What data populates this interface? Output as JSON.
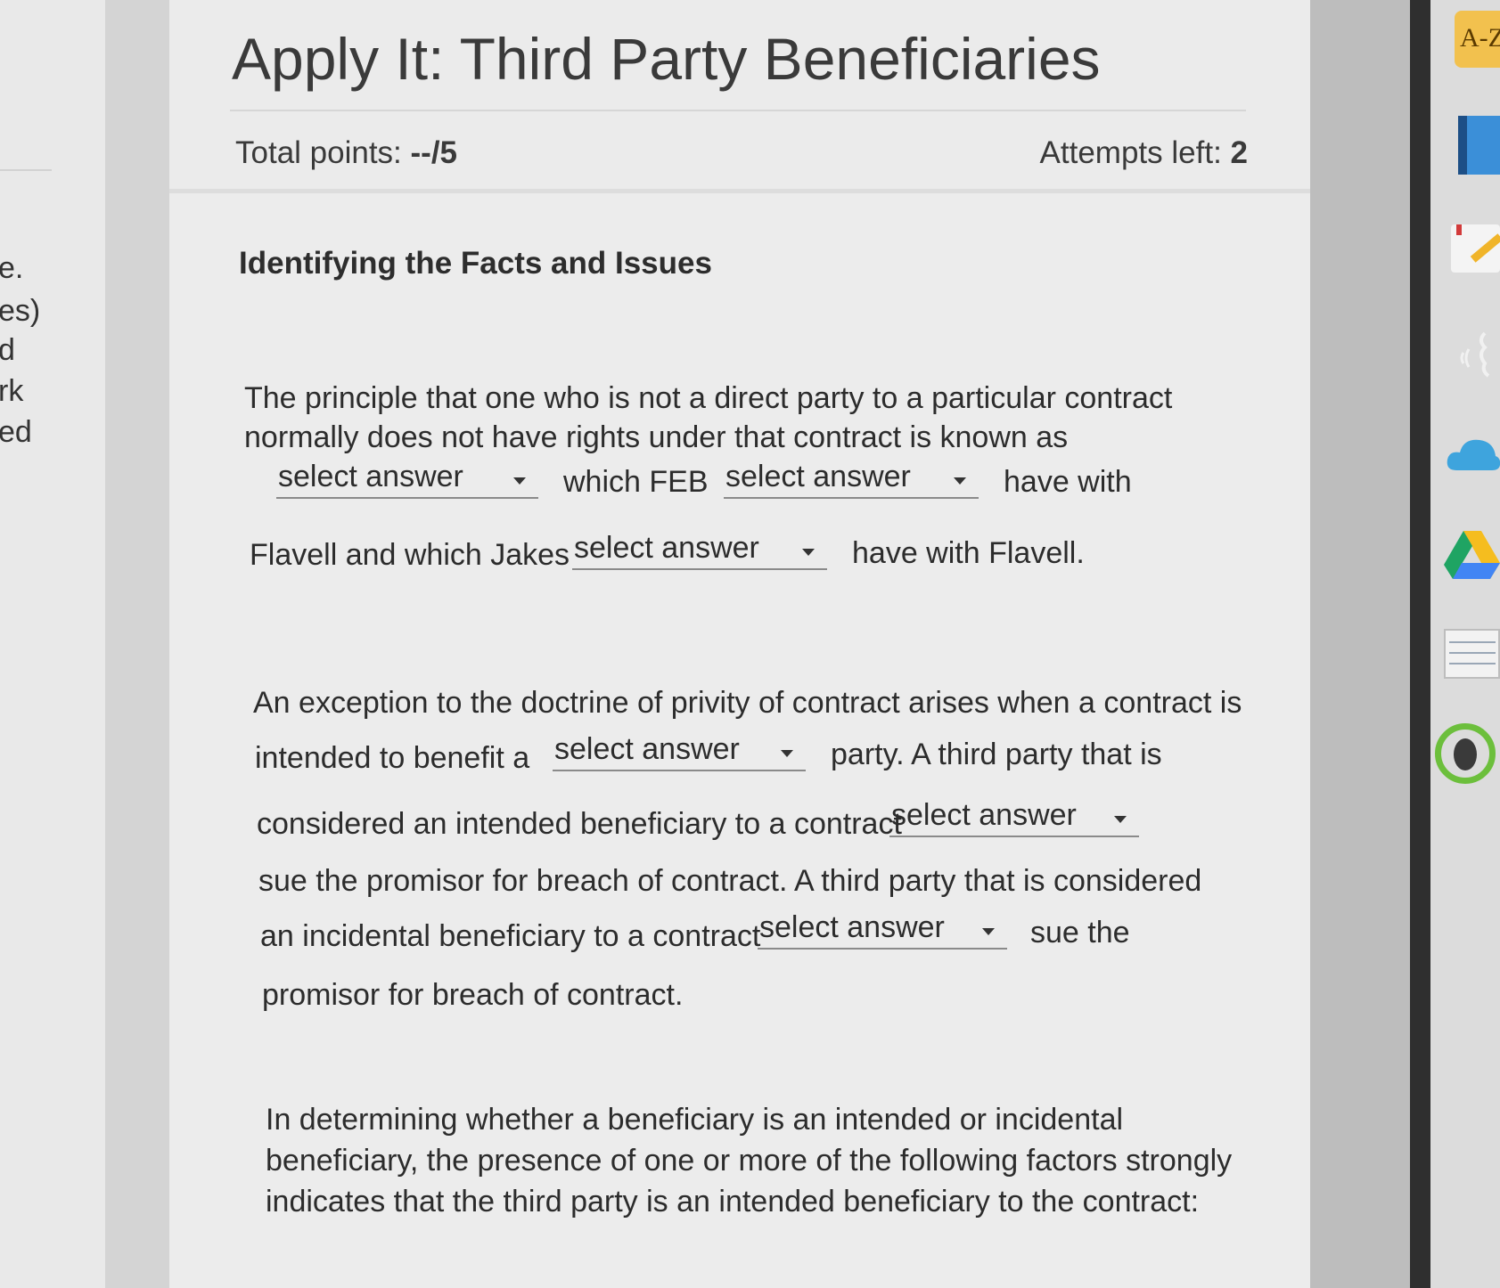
{
  "left_panel": {
    "fragments": [
      "e.",
      "es)",
      "d",
      "rk",
      "ed"
    ]
  },
  "header": {
    "title": "Apply It: Third Party Beneficiaries",
    "total_points_label": "Total points:",
    "total_points_value": "--/5",
    "attempts_label": "Attempts left:",
    "attempts_value": "2"
  },
  "section": {
    "title": "Identifying the Facts and Issues"
  },
  "question1": {
    "line1": "The principle that one who is not a direct party to a particular contract",
    "line2": "normally does not have rights under that contract is known as",
    "text_which_feb": "which FEB",
    "text_have_with": "have with",
    "text_flavell_jakes": "Flavell and which Jakes",
    "text_have_with_flavell": "have with Flavell."
  },
  "question2": {
    "line1": "An exception to the doctrine of privity of contract arises when a contract is",
    "text_intended": "intended to benefit a",
    "text_party": "party. A third party that is",
    "text_considered": "considered an intended beneficiary to a contract",
    "line_sue": "sue the promisor for breach of contract. A third party that is considered",
    "text_incidental": "an incidental beneficiary to a contract",
    "text_sue_the": "sue the",
    "line_end": "promisor for breach of contract."
  },
  "question3": {
    "line1": "In determining whether a beneficiary is an intended or incidental",
    "line2": "beneficiary, the presence of one or more of the following factors strongly",
    "line3": "indicates that the third party is an intended beneficiary to the contract:"
  },
  "dropdown_placeholder": "select answer",
  "dock": {
    "az_label": "A-Z"
  },
  "colors": {
    "page_bg": "#ececec",
    "dock_dark": "#2f2f2f",
    "az_yellow": "#f2c14e",
    "cloud_blue": "#3ea4dd"
  }
}
